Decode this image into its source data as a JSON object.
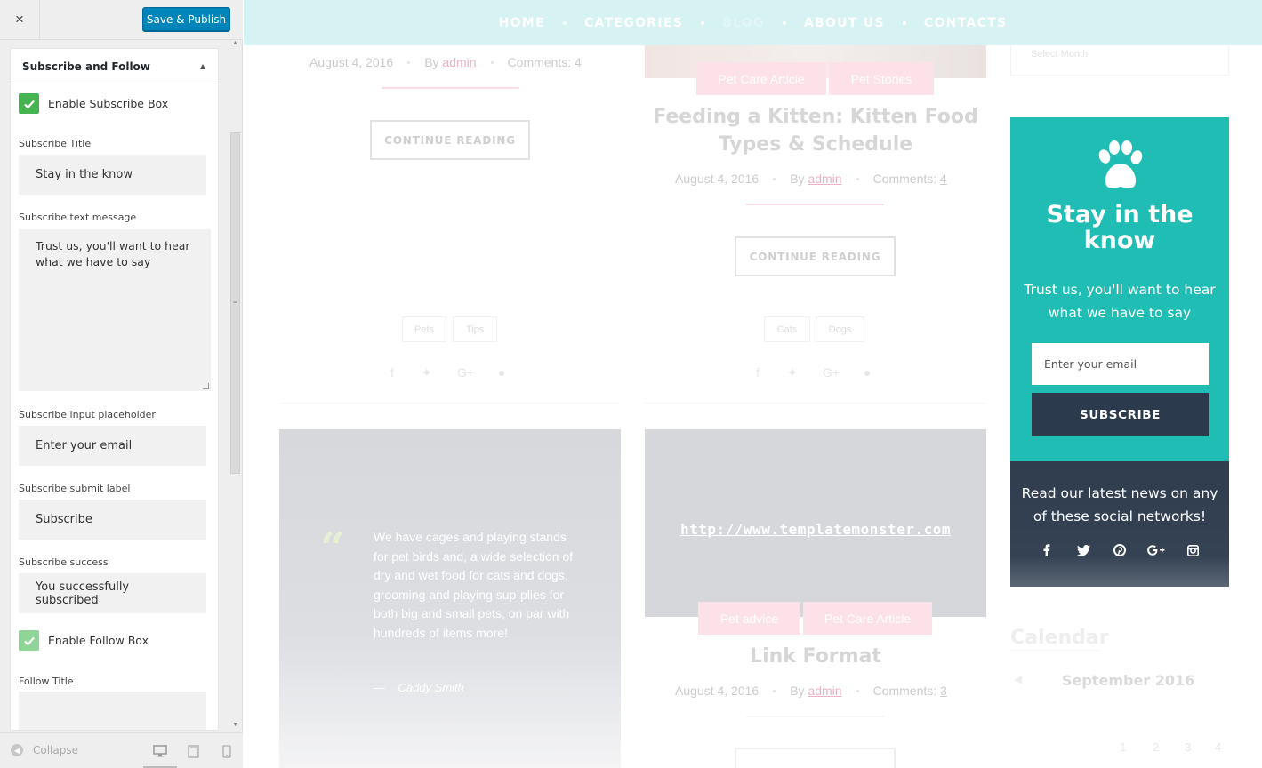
{
  "customizer": {
    "close_label": "×",
    "publish_label": "Save & Publish",
    "section_title": "Subscribe and Follow",
    "enable_subscribe_label": "Enable Subscribe Box",
    "enable_subscribe_checked": true,
    "fields": {
      "subscribe_title_label": "Subscribe Title",
      "subscribe_title_value": "Stay in the know",
      "subscribe_text_label": "Subscribe text message",
      "subscribe_text_value": "Trust us, you'll want to hear what we have to say",
      "placeholder_label": "Subscribe input placeholder",
      "placeholder_value": "Enter your email",
      "submit_label_label": "Subscribe submit label",
      "submit_label_value": "Subscribe",
      "success_label": "Subscribe success",
      "success_value": "You successfully subscribed"
    },
    "enable_follow_label": "Enable Follow Box",
    "enable_follow_checked": true,
    "follow_title_label": "Follow Title",
    "collapse_label": "Collapse"
  },
  "preview": {
    "nav": {
      "items": [
        "HOME",
        "CATEGORIES",
        "BLOG",
        "ABOUT US",
        "CONTACTS"
      ]
    },
    "post_left_top": {
      "date": "August 4, 2016",
      "by": "By",
      "author": "admin",
      "comments_label": "Comments:",
      "comments_count": "4",
      "button": "CONTINUE READING",
      "tags": [
        "Pets",
        "Tips"
      ]
    },
    "post_right_top": {
      "categories": [
        "Pet Care Article",
        "Pet Stories"
      ],
      "title": "Feeding a Kitten: Kitten Food Types & Schedule",
      "date": "August 4, 2016",
      "by": "By",
      "author": "admin",
      "comments_label": "Comments:",
      "comments_count": "4",
      "button": "CONTINUE READING",
      "tags": [
        "Cats",
        "Dogs"
      ]
    },
    "quote_post": {
      "quote": "We have cages and playing stands for pet birds and, a wide selection of dry and wet food for cats and dogs, grooming and playing sup-plies for both big and small pets, on par with hundreds of items more!",
      "author_dash": "—",
      "author": "Caddy Smith"
    },
    "link_post": {
      "url": "http://www.templatemonster.com",
      "categories": [
        "Pet advice",
        "Pet Care Article"
      ],
      "title": "Link Format",
      "date": "August 4, 2016",
      "by": "By",
      "author": "admin",
      "comments_label": "Comments:",
      "comments_count": "3"
    },
    "archive_select": "Select Month",
    "subscribe_widget": {
      "title": "Stay in the know",
      "message": "Trust us, you'll want to hear what we have to say",
      "placeholder": "Enter your email",
      "button": "SUBSCRIBE",
      "bg_color": "#1fbdb3",
      "button_color": "#2c3a4d"
    },
    "follow_widget": {
      "title": "Read our latest news on any of these social networks!",
      "icons": [
        "facebook-icon",
        "twitter-icon",
        "pinterest-icon",
        "google-plus-icon",
        "instagram-icon"
      ]
    },
    "calendar": {
      "title": "Calendar",
      "month": "September 2016",
      "days": [
        "1",
        "2",
        "3",
        "4"
      ]
    }
  }
}
